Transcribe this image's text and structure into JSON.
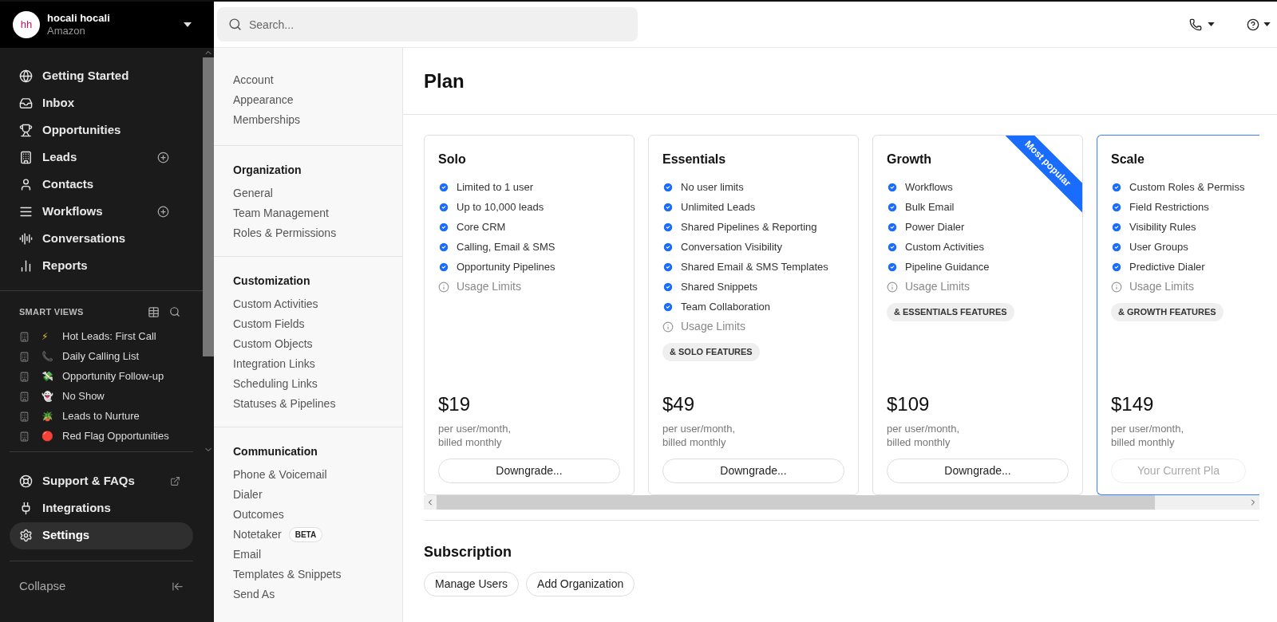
{
  "account": {
    "initials": "hh",
    "name": "hocali hocali",
    "company": "Amazon"
  },
  "nav": [
    {
      "label": "Getting Started",
      "add": false,
      "selected": false
    },
    {
      "label": "Inbox",
      "add": false,
      "selected": false
    },
    {
      "label": "Opportunities",
      "add": false,
      "selected": false
    },
    {
      "label": "Leads",
      "add": true,
      "selected": false
    },
    {
      "label": "Contacts",
      "add": false,
      "selected": false
    },
    {
      "label": "Workflows",
      "add": true,
      "selected": false
    },
    {
      "label": "Conversations",
      "add": false,
      "selected": false
    },
    {
      "label": "Reports",
      "add": false,
      "selected": false
    }
  ],
  "smart_views": {
    "title": "SMART VIEWS",
    "items": [
      {
        "emoji": "⚡",
        "label": "Hot Leads: First Call"
      },
      {
        "emoji": "📞",
        "label": "Daily Calling List"
      },
      {
        "emoji": "💸",
        "label": "Opportunity Follow-up"
      },
      {
        "emoji": "👻",
        "label": "No Show"
      },
      {
        "emoji": "🪴",
        "label": "Leads to Nurture"
      },
      {
        "emoji": "🔴",
        "label": "Red Flag Opportunities"
      }
    ]
  },
  "bottom_nav": [
    {
      "label": "Support & FAQs",
      "external": true,
      "selected": false
    },
    {
      "label": "Integrations",
      "external": false,
      "selected": false
    },
    {
      "label": "Settings",
      "external": false,
      "selected": true
    }
  ],
  "collapse": "Collapse",
  "search": {
    "placeholder": "Search..."
  },
  "settings_nav": [
    {
      "items": [
        {
          "label": "Account"
        },
        {
          "label": "Appearance"
        },
        {
          "label": "Memberships"
        }
      ]
    },
    {
      "title": "Organization",
      "items": [
        {
          "label": "General"
        },
        {
          "label": "Team Management"
        },
        {
          "label": "Roles & Permissions"
        }
      ]
    },
    {
      "title": "Customization",
      "items": [
        {
          "label": "Custom Activities"
        },
        {
          "label": "Custom Fields"
        },
        {
          "label": "Custom Objects"
        },
        {
          "label": "Integration Links"
        },
        {
          "label": "Scheduling Links"
        },
        {
          "label": "Statuses & Pipelines"
        }
      ]
    },
    {
      "title": "Communication",
      "items": [
        {
          "label": "Phone & Voicemail"
        },
        {
          "label": "Dialer"
        },
        {
          "label": "Outcomes"
        },
        {
          "label": "Notetaker",
          "badge": "BETA"
        },
        {
          "label": "Email"
        },
        {
          "label": "Templates & Snippets"
        },
        {
          "label": "Send As"
        }
      ]
    }
  ],
  "page_title": "Plan",
  "plans": [
    {
      "name": "Solo",
      "current": false,
      "features": [
        {
          "kind": "check",
          "text": "Limited to 1 user"
        },
        {
          "kind": "check",
          "text": "Up to 10,000 leads"
        },
        {
          "kind": "check",
          "text": "Core CRM"
        },
        {
          "kind": "check",
          "text": "Calling, Email & SMS"
        },
        {
          "kind": "check",
          "text": "Opportunity Pipelines"
        },
        {
          "kind": "info",
          "text": "Usage Limits"
        }
      ],
      "price": "$19",
      "period": "per user/month,",
      "billing": "billed monthly",
      "button": "Downgrade..."
    },
    {
      "name": "Essentials",
      "current": false,
      "features": [
        {
          "kind": "check",
          "text": "No user limits"
        },
        {
          "kind": "check",
          "text": "Unlimited Leads"
        },
        {
          "kind": "check",
          "text": "Shared Pipelines & Reporting"
        },
        {
          "kind": "check",
          "text": "Conversation Visibility"
        },
        {
          "kind": "check",
          "text": "Shared Email & SMS Templates"
        },
        {
          "kind": "check",
          "text": "Shared Snippets"
        },
        {
          "kind": "check",
          "text": "Team Collaboration"
        },
        {
          "kind": "info",
          "text": "Usage Limits"
        }
      ],
      "tag": "& SOLO FEATURES",
      "price": "$49",
      "period": "per user/month,",
      "billing": "billed monthly",
      "button": "Downgrade..."
    },
    {
      "name": "Growth",
      "ribbon": "Most popular",
      "current": false,
      "features": [
        {
          "kind": "check",
          "text": "Workflows"
        },
        {
          "kind": "check",
          "text": "Bulk Email"
        },
        {
          "kind": "check",
          "text": "Power Dialer"
        },
        {
          "kind": "check",
          "text": "Custom Activities"
        },
        {
          "kind": "check",
          "text": "Pipeline Guidance"
        },
        {
          "kind": "info",
          "text": "Usage Limits"
        }
      ],
      "tag": "& ESSENTIALS FEATURES",
      "price": "$109",
      "period": "per user/month,",
      "billing": "billed monthly",
      "button": "Downgrade..."
    },
    {
      "name": "Scale",
      "current": true,
      "features": [
        {
          "kind": "check",
          "text": "Custom Roles & Permiss"
        },
        {
          "kind": "check",
          "text": "Field Restrictions"
        },
        {
          "kind": "check",
          "text": "Visibility Rules"
        },
        {
          "kind": "check",
          "text": "User Groups"
        },
        {
          "kind": "check",
          "text": "Predictive Dialer"
        },
        {
          "kind": "info",
          "text": "Usage Limits"
        }
      ],
      "tag": "& GROWTH FEATURES",
      "price": "$149",
      "period": "per user/month,",
      "billing": "billed monthly",
      "button": "Your Current Pla"
    }
  ],
  "subscription": {
    "title": "Subscription",
    "buttons": [
      "Manage Users",
      "Add Organization"
    ]
  }
}
